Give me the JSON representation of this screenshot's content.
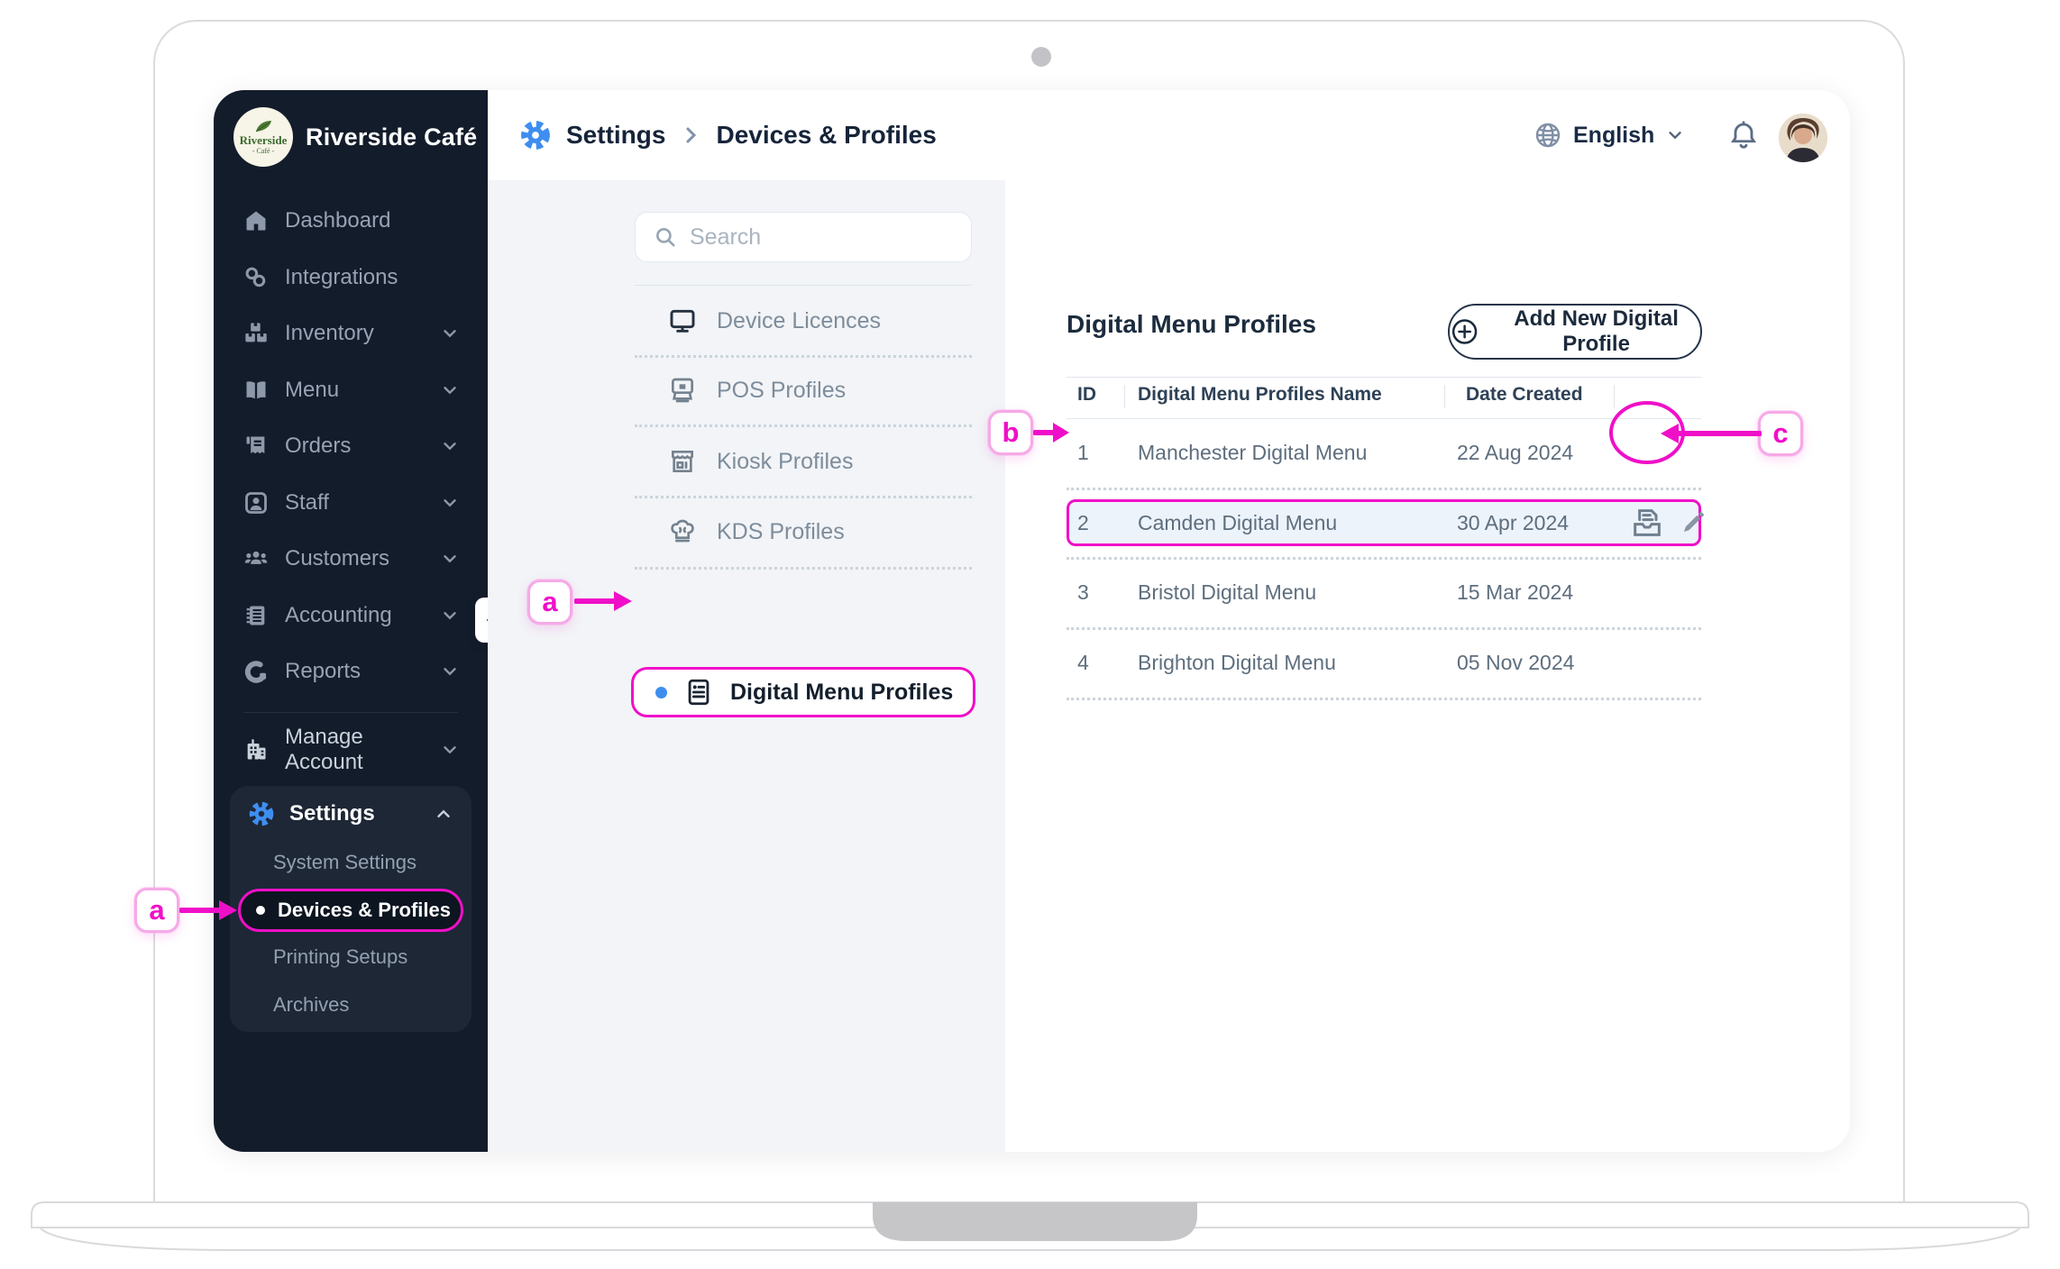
{
  "colors": {
    "magenta": "#F00FC8",
    "badge_border": "#F6A9E7",
    "accent_blue": "#3E8EF0",
    "sidebar_bg": "#131C2A",
    "sidebar_panel_bg": "#1D2736",
    "active_item_bg": "#0C1520",
    "subnav_bg": "#F2F4F7",
    "row_highlight_bg": "#EDF3FA"
  },
  "brand": {
    "name": "Riverside Café",
    "logo_top": "Riverside",
    "logo_bottom": "- Café -"
  },
  "sidebar": {
    "items": [
      {
        "label": "Dashboard"
      },
      {
        "label": "Integrations"
      },
      {
        "label": "Inventory"
      },
      {
        "label": "Menu"
      },
      {
        "label": "Orders"
      },
      {
        "label": "Staff"
      },
      {
        "label": "Customers"
      },
      {
        "label": "Accounting"
      },
      {
        "label": "Reports"
      }
    ],
    "manage_account": {
      "label": "Manage Account"
    },
    "settings": {
      "label": "Settings",
      "subitems": [
        {
          "label": "System Settings"
        },
        {
          "label": "Devices & Profiles"
        },
        {
          "label": "Printing Setups"
        },
        {
          "label": "Archives"
        }
      ],
      "active_subitem": "Devices & Profiles"
    }
  },
  "topbar": {
    "breadcrumb": {
      "root": "Settings",
      "current": "Devices & Profiles"
    },
    "language": "English"
  },
  "settings_nav": {
    "search_placeholder": "Search",
    "items": [
      {
        "label": "Device Licences"
      },
      {
        "label": "POS Profiles"
      },
      {
        "label": "Kiosk Profiles"
      },
      {
        "label": "KDS Profiles"
      },
      {
        "label": "Digital Menu Profiles"
      }
    ],
    "active_item": "Digital Menu Profiles"
  },
  "main": {
    "title": "Digital Menu Profiles",
    "add_button_label": "Add New Digital Profile",
    "table": {
      "columns": [
        "ID",
        "Digital Menu Profiles Name",
        "Date Created"
      ],
      "rows": [
        {
          "id": "1",
          "name": "Manchester Digital Menu",
          "date": "22 Aug 2024"
        },
        {
          "id": "2",
          "name": "Camden Digital Menu",
          "date": "30 Apr 2024"
        },
        {
          "id": "3",
          "name": "Bristol Digital Menu",
          "date": "15 Mar 2024"
        },
        {
          "id": "4",
          "name": "Brighton Digital Menu",
          "date": "05 Nov 2024"
        }
      ],
      "highlighted_row": "2"
    }
  },
  "annotations": {
    "a_sidebar": "a",
    "a_subnav": "a",
    "b": "b",
    "c": "c"
  }
}
